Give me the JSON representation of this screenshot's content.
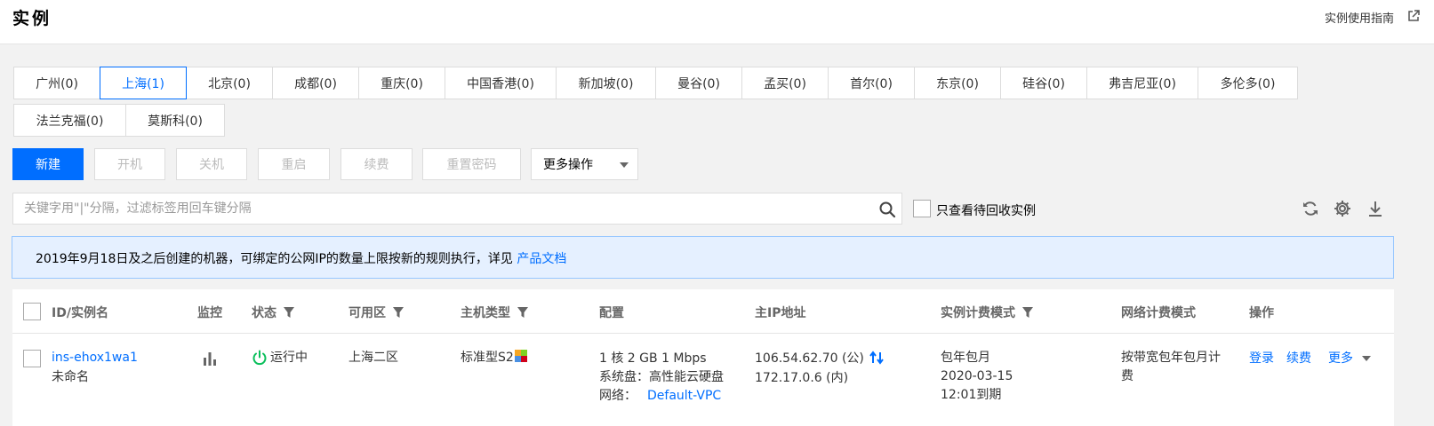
{
  "header": {
    "title": "实例",
    "guide_link": "实例使用指南"
  },
  "regions": [
    {
      "label": "广州(0)",
      "active": false
    },
    {
      "label": "上海(1)",
      "active": true
    },
    {
      "label": "北京(0)",
      "active": false
    },
    {
      "label": "成都(0)",
      "active": false
    },
    {
      "label": "重庆(0)",
      "active": false
    },
    {
      "label": "中国香港(0)",
      "active": false
    },
    {
      "label": "新加坡(0)",
      "active": false
    },
    {
      "label": "曼谷(0)",
      "active": false
    },
    {
      "label": "孟买(0)",
      "active": false
    },
    {
      "label": "首尔(0)",
      "active": false
    },
    {
      "label": "东京(0)",
      "active": false
    },
    {
      "label": "硅谷(0)",
      "active": false
    },
    {
      "label": "弗吉尼亚(0)",
      "active": false
    },
    {
      "label": "多伦多(0)",
      "active": false
    },
    {
      "label": "法兰克福(0)",
      "active": false
    },
    {
      "label": "莫斯科(0)",
      "active": false
    }
  ],
  "toolbar": {
    "new": "新建",
    "start": "开机",
    "shutdown": "关机",
    "restart": "重启",
    "renew": "续费",
    "reset_password": "重置密码",
    "more_actions": "更多操作"
  },
  "search": {
    "placeholder": "关键字用\"|\"分隔，过滤标签用回车键分隔"
  },
  "recycle_filter": {
    "label": "只查看待回收实例",
    "checked": false
  },
  "notice": {
    "text": "2019年9月18日及之后创建的机器，可绑定的公网IP的数量上限按新的规则执行，详见 ",
    "link": "产品文档"
  },
  "table": {
    "columns": {
      "id": "ID/实例名",
      "monitor": "监控",
      "status": "状态",
      "zone": "可用区",
      "type": "主机类型",
      "config": "配置",
      "ip": "主IP地址",
      "billing": "实例计费模式",
      "network_billing": "网络计费模式",
      "actions": "操作"
    },
    "rows": [
      {
        "id": "ins-ehox1wa1",
        "name": "未命名",
        "status": "运行中",
        "zone": "上海二区",
        "type": "标准型S2",
        "config_line1": "1 核 2 GB 1 Mbps",
        "config_line2": "系统盘：高性能云硬盘",
        "config_line3_label": "网络：",
        "config_line3_link": "Default-VPC",
        "ip_public": "106.54.62.70 (公)",
        "ip_private": "172.17.0.6 (内)",
        "billing_mode": "包年包月",
        "billing_date": "2020-03-15",
        "billing_expire": "12:01到期",
        "network_billing_line1": "按带宽包年包月计",
        "network_billing_line2": "费",
        "action_login": "登录",
        "action_renew": "续费",
        "action_more": "更多"
      }
    ]
  },
  "colors": {
    "accent": "#006eff",
    "status_running": "#0abf5b",
    "notice_bg": "#e5f0ff"
  }
}
